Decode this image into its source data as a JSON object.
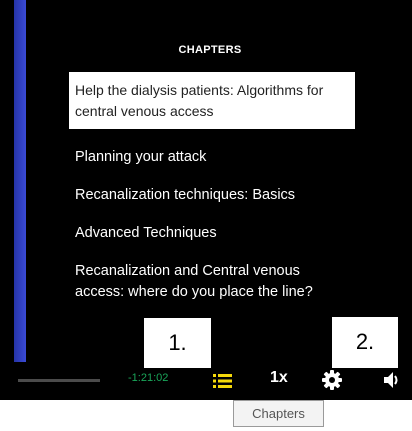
{
  "chapters_panel": {
    "title": "CHAPTERS",
    "items": [
      {
        "label": "Help the dialysis patients: Algorithms for central venous access",
        "active": true
      },
      {
        "label": "Planning your attack",
        "active": false
      },
      {
        "label": "Recanalization techniques: Basics",
        "active": false
      },
      {
        "label": "Advanced Techniques",
        "active": false
      },
      {
        "label": "Recanalization and Central venous access: where do you place the line?",
        "active": false
      }
    ]
  },
  "callouts": {
    "first": "1.",
    "second": "2."
  },
  "controls": {
    "time_remaining": "-1:21:02",
    "playback_speed": "1x",
    "chapters_icon": "list-icon",
    "settings_icon": "gear-icon",
    "volume_icon": "speaker-icon"
  },
  "tooltip": {
    "label": "Chapters"
  },
  "colors": {
    "background": "#000000",
    "accent_blue": "#3a4bd6",
    "time_green": "#1aa65a",
    "chapters_icon_yellow": "#f5d90a"
  }
}
